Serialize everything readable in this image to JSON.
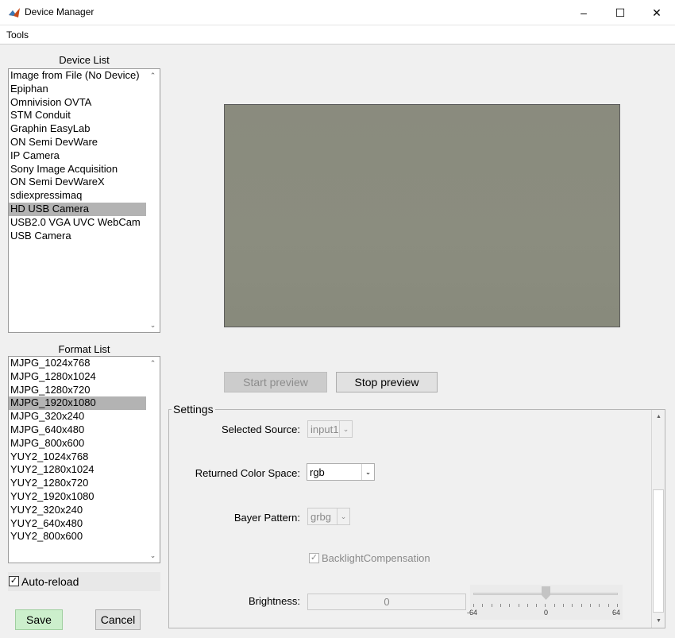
{
  "window": {
    "title": "Device Manager",
    "minimize_glyph": "–",
    "maximize_glyph": "☐",
    "close_glyph": "✕"
  },
  "menu": {
    "tools": "Tools"
  },
  "device_list": {
    "title": "Device List",
    "items": [
      "Image from File (No Device)",
      "Epiphan",
      "Omnivision OVTA",
      "STM Conduit",
      "Graphin EasyLab",
      "ON Semi DevWare",
      "IP Camera",
      "Sony Image Acquisition",
      "ON Semi DevWareX",
      "sdiexpressimaq",
      "HD USB Camera",
      "USB2.0 VGA UVC WebCam",
      "USB  Camera"
    ],
    "selected": "HD USB Camera"
  },
  "format_list": {
    "title": "Format List",
    "items": [
      "MJPG_1024x768",
      "MJPG_1280x1024",
      "MJPG_1280x720",
      "MJPG_1920x1080",
      "MJPG_320x240",
      "MJPG_640x480",
      "MJPG_800x600",
      "YUY2_1024x768",
      "YUY2_1280x1024",
      "YUY2_1280x720",
      "YUY2_1920x1080",
      "YUY2_320x240",
      "YUY2_640x480",
      "YUY2_800x600"
    ],
    "selected": "MJPG_1920x1080"
  },
  "auto_reload": {
    "label": "Auto-reload",
    "checked": true,
    "mark": "✓"
  },
  "buttons": {
    "save": "Save",
    "cancel": "Cancel",
    "start_preview": "Start preview",
    "stop_preview": "Stop preview"
  },
  "settings": {
    "legend": "Settings",
    "selected_source": {
      "label": "Selected Source:",
      "value": "input1"
    },
    "color_space": {
      "label": "Returned Color Space:",
      "value": "rgb"
    },
    "bayer_pattern": {
      "label": "Bayer Pattern:",
      "value": "grbg"
    },
    "backlight": {
      "label": "BacklightCompensation",
      "checked": true,
      "mark": "✓"
    },
    "brightness": {
      "label": "Brightness:",
      "value": "0",
      "min_label": "-64",
      "mid_label": "0",
      "max_label": "64"
    }
  },
  "icons": {
    "scroll_up": "▲",
    "scroll_down": "▼",
    "chevron_up": "⌃",
    "chevron_down": "⌄",
    "dropdown_arrow": "⌄"
  },
  "colors": {
    "save_button_bg": "#ccefcc",
    "selection_bg": "#b3b3b3",
    "preview_bg": "#8a8b7e"
  }
}
